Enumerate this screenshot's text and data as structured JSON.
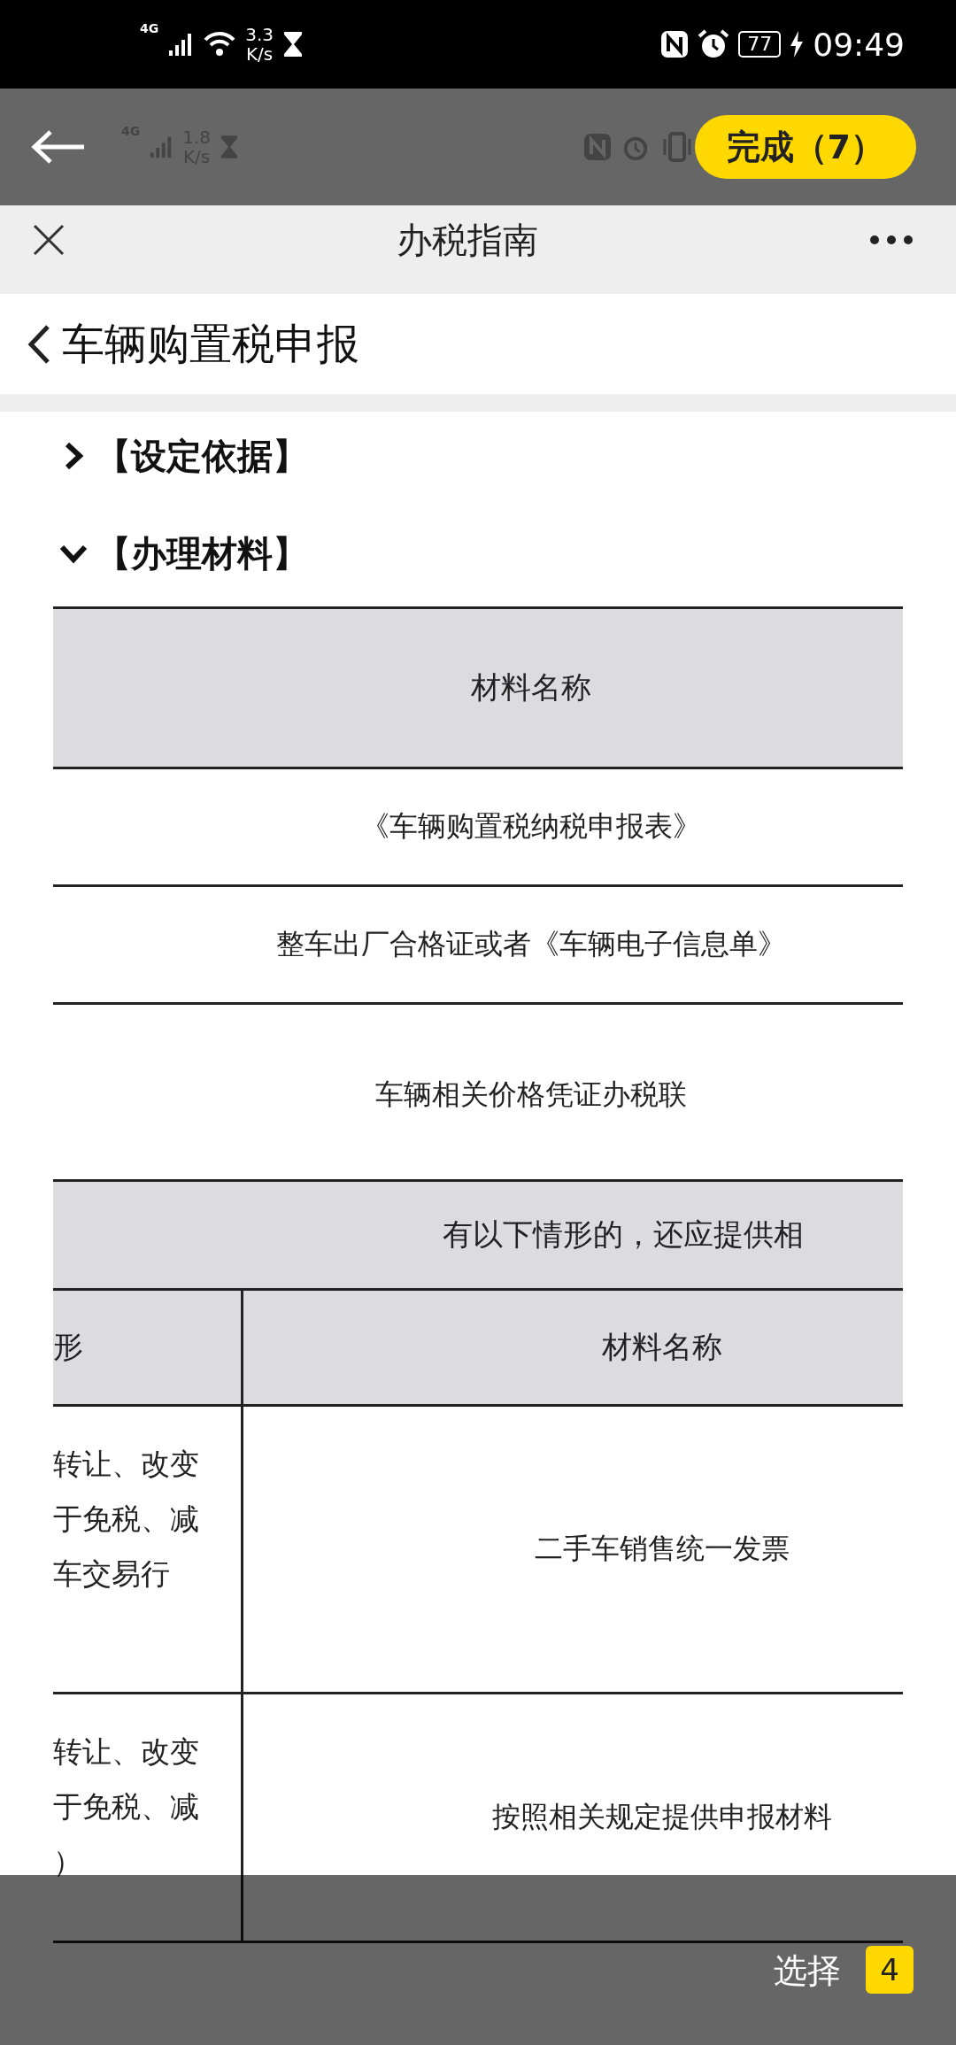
{
  "status_bar": {
    "network": "4G",
    "speed": "3.3",
    "speed_unit": "K/s",
    "battery": "77",
    "time": "09:49"
  },
  "toolbar": {
    "ghost_network": "4G",
    "ghost_speed": "1.8",
    "ghost_speed_unit": "K/s",
    "done_button": "完成（7）"
  },
  "nav_bar": {
    "title": "办税指南"
  },
  "page_title": "车辆购置税申报",
  "sections": [
    {
      "label": "【设定依据】",
      "expanded": false
    },
    {
      "label": "【办理材料】",
      "expanded": true
    }
  ],
  "table_1": {
    "header": "材料名称",
    "rows": [
      "《车辆购置税纳税申报表》",
      "整车出厂合格证或者《车辆电子信息单》",
      "车辆相关价格凭证办税联"
    ]
  },
  "table_2": {
    "title": "有以下情形的，还应提供相",
    "column_1": "形",
    "column_2": "材料名称",
    "rows": [
      {
        "condition": [
          "转让、改变",
          "于免税、减",
          "车交易行"
        ],
        "material": "二手车销售统一发票"
      },
      {
        "condition": [
          "转让、改变",
          "于免税、减",
          "）"
        ],
        "material": "按照相关规定提供申报材料"
      }
    ]
  },
  "selection_bar": {
    "label": "选择",
    "count": "4"
  }
}
